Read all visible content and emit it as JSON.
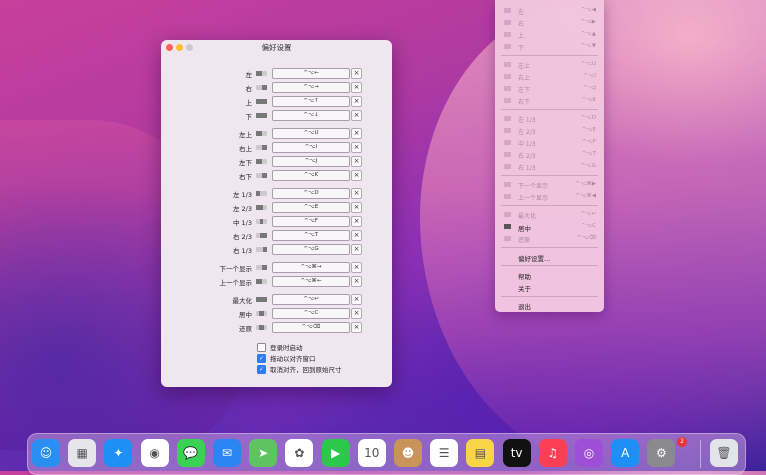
{
  "window": {
    "title": "偏好设置"
  },
  "rows": [
    {
      "label": "左",
      "shortcut": "^⌥←",
      "clear": "×",
      "icon": "left-half-icon"
    },
    {
      "label": "右",
      "shortcut": "^⌥→",
      "clear": "×",
      "icon": "right-half-icon"
    },
    {
      "label": "上",
      "shortcut": "^⌥↑",
      "clear": "×",
      "icon": "top-half-icon"
    },
    {
      "label": "下",
      "shortcut": "^⌥↓",
      "clear": "×",
      "icon": "bottom-half-icon"
    },
    {
      "label": "左上",
      "shortcut": "^⌥U",
      "clear": "×",
      "icon": "top-left-icon"
    },
    {
      "label": "右上",
      "shortcut": "^⌥I",
      "clear": "×",
      "icon": "top-right-icon"
    },
    {
      "label": "左下",
      "shortcut": "^⌥J",
      "clear": "×",
      "icon": "bottom-left-icon"
    },
    {
      "label": "右下",
      "shortcut": "^⌥K",
      "clear": "×",
      "icon": "bottom-right-icon"
    },
    {
      "label": "左 1/3",
      "shortcut": "^⌥D",
      "clear": "×",
      "icon": "left-third-icon"
    },
    {
      "label": "左 2/3",
      "shortcut": "^⌥E",
      "clear": "×",
      "icon": "left-two-thirds-icon"
    },
    {
      "label": "中 1/3",
      "shortcut": "^⌥F",
      "clear": "×",
      "icon": "center-third-icon"
    },
    {
      "label": "右 2/3",
      "shortcut": "^⌥T",
      "clear": "×",
      "icon": "right-two-thirds-icon"
    },
    {
      "label": "右 1/3",
      "shortcut": "^⌥G",
      "clear": "×",
      "icon": "right-third-icon"
    },
    {
      "label": "下一个显示",
      "shortcut": "^⌥⌘→",
      "clear": "×",
      "icon": "next-display-icon"
    },
    {
      "label": "上一个显示",
      "shortcut": "^⌥⌘←",
      "clear": "×",
      "icon": "previous-display-icon"
    },
    {
      "label": "最大化",
      "shortcut": "^⌥↩",
      "clear": "×",
      "icon": "maximize-icon"
    },
    {
      "label": "居中",
      "shortcut": "^⌥C",
      "clear": "×",
      "icon": "center-icon"
    },
    {
      "label": "还原",
      "shortcut": "^⌥⌫",
      "clear": "×",
      "icon": "restore-icon"
    }
  ],
  "checkboxes": [
    {
      "label": "登录时启动",
      "checked": false
    },
    {
      "label": "拖动以对齐窗口",
      "checked": true
    },
    {
      "label": "取消对齐，回到原始尺寸",
      "checked": true
    }
  ],
  "menu": {
    "items": [
      {
        "label": "左",
        "key": "^⌥◀",
        "enabled": false
      },
      {
        "label": "右",
        "key": "^⌥▶",
        "enabled": false
      },
      {
        "label": "上",
        "key": "^⌥▲",
        "enabled": false
      },
      {
        "label": "下",
        "key": "^⌥▼",
        "enabled": false
      },
      {
        "label": "左上",
        "key": "^⌥U",
        "enabled": false
      },
      {
        "label": "右上",
        "key": "^⌥I",
        "enabled": false
      },
      {
        "label": "左下",
        "key": "^⌥J",
        "enabled": false
      },
      {
        "label": "右下",
        "key": "^⌥K",
        "enabled": false
      },
      {
        "label": "左 1/3",
        "key": "^⌥D",
        "enabled": false
      },
      {
        "label": "左 2/3",
        "key": "^⌥E",
        "enabled": false
      },
      {
        "label": "中 1/3",
        "key": "^⌥F",
        "enabled": false
      },
      {
        "label": "右 2/3",
        "key": "^⌥T",
        "enabled": false
      },
      {
        "label": "右 1/3",
        "key": "^⌥G",
        "enabled": false
      },
      {
        "label": "下一个显示",
        "key": "^⌥⌘▶",
        "enabled": false
      },
      {
        "label": "上一个显示",
        "key": "^⌥⌘◀",
        "enabled": false
      },
      {
        "label": "最大化",
        "key": "^⌥↩",
        "enabled": false
      },
      {
        "label": "居中",
        "key": "^⌥C",
        "enabled": true
      },
      {
        "label": "还原",
        "key": "^⌥⌫",
        "enabled": false
      }
    ],
    "preferences": "偏好设置...",
    "help": "帮助",
    "about": "关于",
    "quit": "退出"
  },
  "dock": {
    "apps": [
      {
        "name": "finder-icon",
        "glyph": "☺",
        "color": "#2a8ff0"
      },
      {
        "name": "launchpad-icon",
        "glyph": "▦",
        "color": "#e6e6ea"
      },
      {
        "name": "safari-icon",
        "glyph": "✦",
        "color": "#1d8ff5"
      },
      {
        "name": "chrome-icon",
        "glyph": "◉",
        "color": "#ffffff"
      },
      {
        "name": "messages-icon",
        "glyph": "💬",
        "color": "#3bd155"
      },
      {
        "name": "mail-icon",
        "glyph": "✉",
        "color": "#2b86f4"
      },
      {
        "name": "maps-icon",
        "glyph": "➤",
        "color": "#5fc45f"
      },
      {
        "name": "photos-icon",
        "glyph": "✿",
        "color": "#ffffff"
      },
      {
        "name": "facetime-icon",
        "glyph": "▶",
        "color": "#2cc84b"
      },
      {
        "name": "calendar-icon",
        "glyph": "10",
        "color": "#ffffff"
      },
      {
        "name": "contacts-icon",
        "glyph": "☻",
        "color": "#c8945a"
      },
      {
        "name": "reminders-icon",
        "glyph": "☰",
        "color": "#ffffff"
      },
      {
        "name": "notes-icon",
        "glyph": "▤",
        "color": "#f8d447"
      },
      {
        "name": "appletv-icon",
        "glyph": "tv",
        "color": "#111111"
      },
      {
        "name": "music-icon",
        "glyph": "♫",
        "color": "#fb3f55"
      },
      {
        "name": "podcasts-icon",
        "glyph": "◎",
        "color": "#9d4fd8"
      },
      {
        "name": "appstore-icon",
        "glyph": "A",
        "color": "#1d8ff5"
      },
      {
        "name": "system-preferences-icon",
        "glyph": "⚙",
        "color": "#8a8a8e"
      },
      {
        "name": "trash-icon",
        "glyph": "🗑",
        "color": "#e3e3ea"
      }
    ],
    "calendar_month": "5月",
    "settings_badge": "2"
  }
}
